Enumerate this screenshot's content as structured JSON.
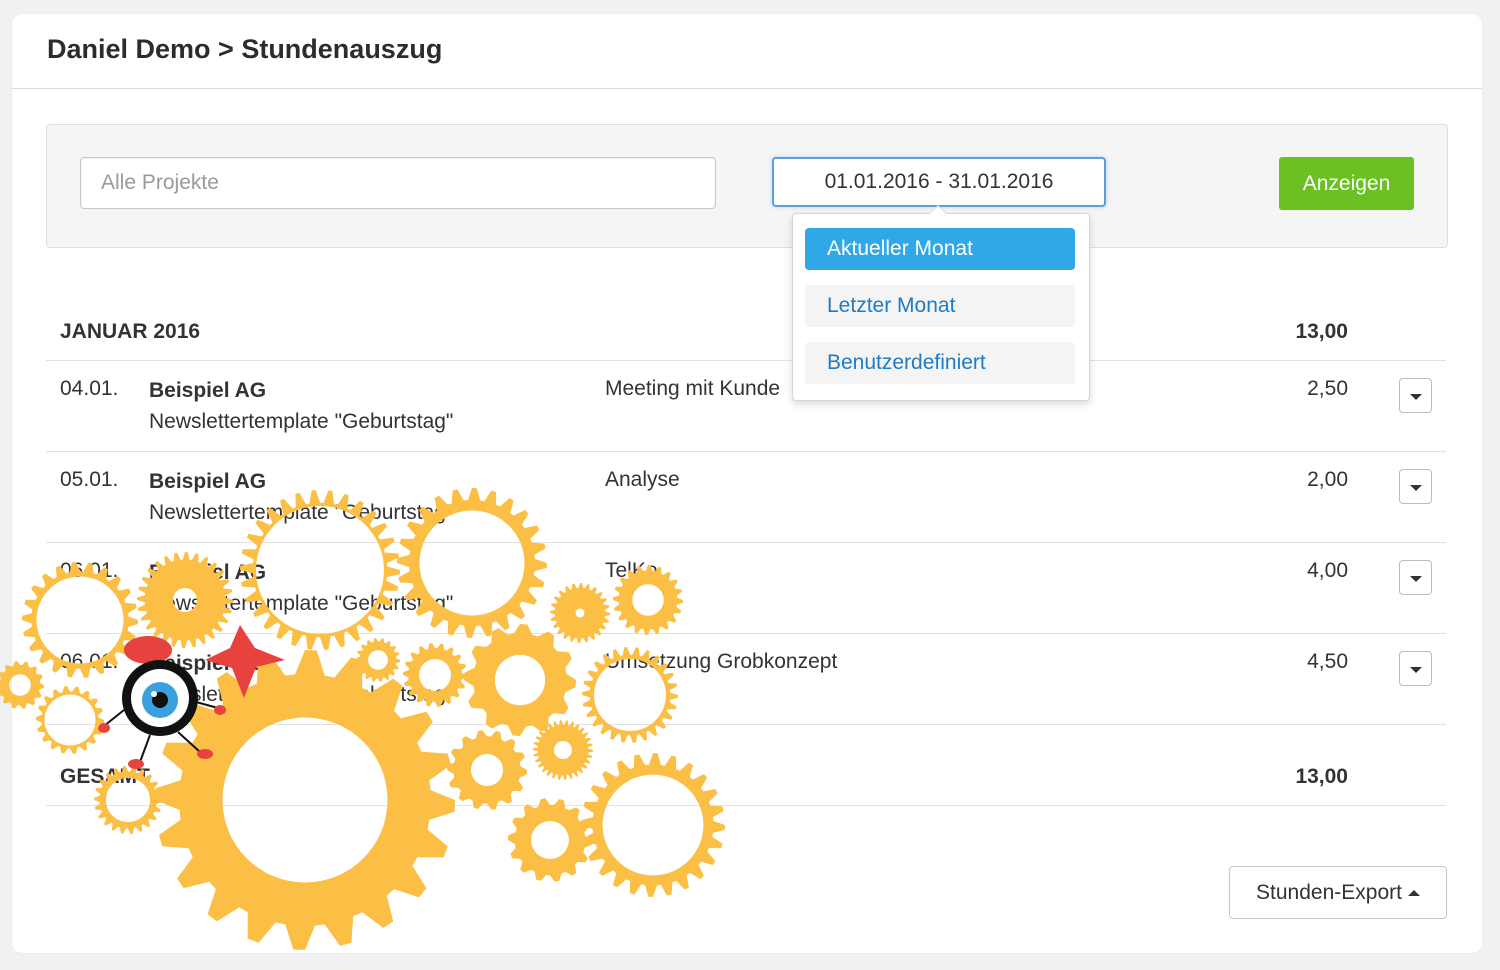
{
  "header": {
    "title": "Daniel Demo > Stundenauszug"
  },
  "filters": {
    "project_placeholder": "Alle Projekte",
    "date_range": "01.01.2016 - 31.01.2016",
    "show_label": "Anzeigen"
  },
  "date_dropdown": {
    "items": [
      {
        "label": "Aktueller Monat",
        "active": true
      },
      {
        "label": "Letzter Monat",
        "active": false
      },
      {
        "label": "Benutzerdefiniert",
        "active": false
      }
    ]
  },
  "report": {
    "month_label": "JANUAR 2016",
    "month_total": "13,00",
    "entries": [
      {
        "date": "04.01.",
        "client": "Beispiel AG",
        "project": "Newslettertemplate \"Geburtstag\"",
        "description": "Meeting mit Kunde",
        "hours": "2,50"
      },
      {
        "date": "05.01.",
        "client": "Beispiel AG",
        "project": "Newslettertemplate \"Geburtstag\"",
        "description": "Analyse",
        "hours": "2,00"
      },
      {
        "date": "06.01.",
        "client": "Beispiel AG",
        "project": "Newslettertemplate \"Geburtstag\"",
        "description": "TelKo",
        "hours": "4,00"
      },
      {
        "date": "06.01.",
        "client": "Beispiel AG",
        "project": "Newslettertemplate \"Geburtstag\"",
        "description": "Umsetzung Grobkonzept",
        "hours": "4,50"
      }
    ],
    "total_label": "GESAMT",
    "total_value": "13,00"
  },
  "export": {
    "label": "Stunden-Export"
  },
  "colors": {
    "accent_green": "#6ac121",
    "accent_blue": "#30a7e6",
    "link_blue": "#1e7bc4",
    "gear_yellow": "#fbbf45"
  },
  "icons": {
    "row_toggle": "caret-down-icon",
    "export_toggle": "caret-up-icon",
    "illustration": "gears-illustration"
  }
}
